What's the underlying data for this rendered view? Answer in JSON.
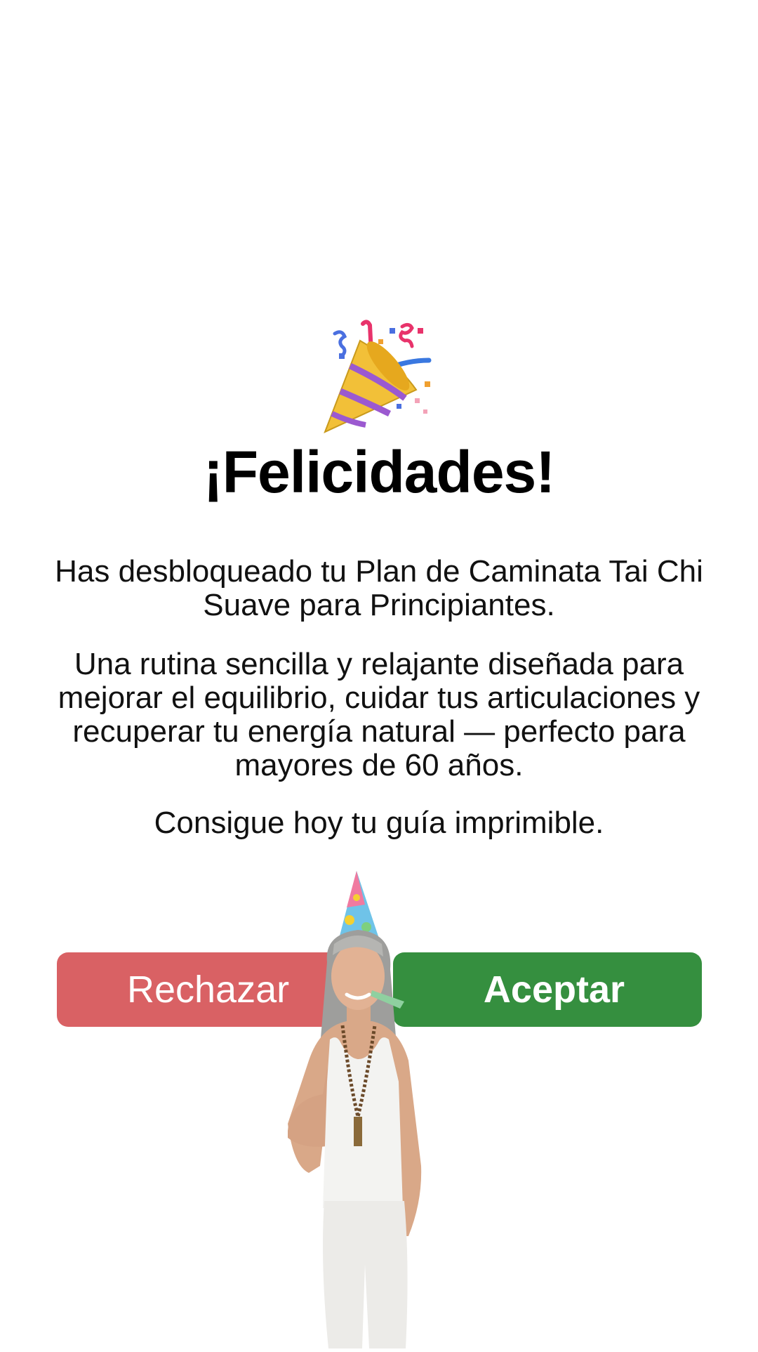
{
  "icons": {
    "popper": "party-popper-icon",
    "woman": "celebrating-woman-illustration"
  },
  "content": {
    "title": "¡Felicidades!",
    "paragraph_1": "Has desbloqueado tu Plan de Caminata Tai Chi Suave para Principiantes.",
    "paragraph_2": "Una rutina sencilla y relajante diseñada para mejorar el equilibrio, cuidar tus articulaciones y recuperar tu energía natural — perfecto para mayores de 60 años.",
    "paragraph_3": "Consigue hoy tu guía imprimible."
  },
  "buttons": {
    "reject_label": "Rechazar",
    "accept_label": "Aceptar"
  },
  "colors": {
    "reject": "#d96164",
    "accept": "#358f3f",
    "background": "#ffffff"
  }
}
